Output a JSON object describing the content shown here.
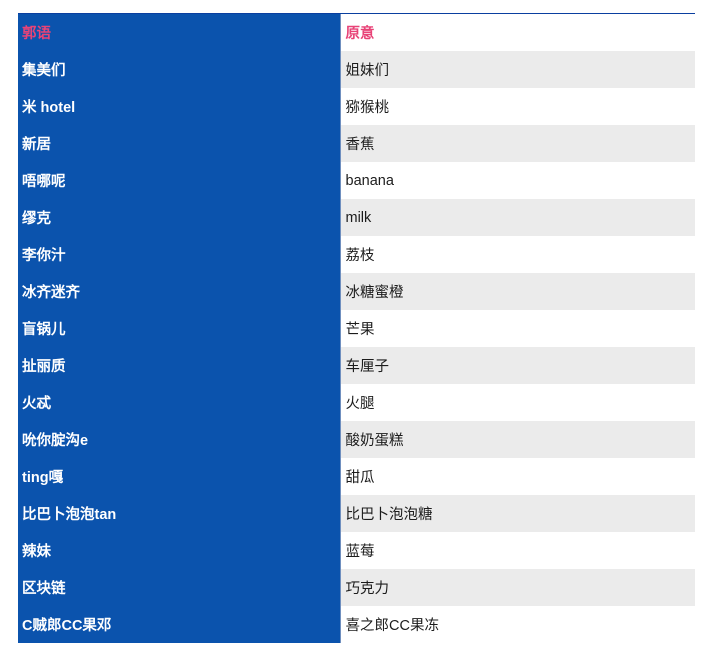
{
  "table": {
    "headers": [
      "郭语",
      "原意"
    ],
    "rows": [
      [
        "集美们",
        "姐妹们"
      ],
      [
        "米 hotel",
        "猕猴桃"
      ],
      [
        "新居",
        "香蕉"
      ],
      [
        "唔哪呢",
        "banana"
      ],
      [
        "缪克",
        "milk"
      ],
      [
        "李你汁",
        "荔枝"
      ],
      [
        "冰齐迷齐",
        "冰糖蜜橙"
      ],
      [
        "盲锅儿",
        "芒果"
      ],
      [
        "扯丽质",
        "车厘子"
      ],
      [
        "火忒",
        "火腿"
      ],
      [
        "吮你腚沟e",
        "酸奶蛋糕"
      ],
      [
        "ting嘎",
        "甜瓜"
      ],
      [
        "比巴卜泡泡tan",
        "比巴卜泡泡糖"
      ],
      [
        "辣妹",
        "蓝莓"
      ],
      [
        "区块链",
        "巧克力"
      ],
      [
        "C贼郎CC果邓",
        "喜之郎CC果冻"
      ]
    ]
  },
  "colors": {
    "left_column_bg": "#0b53ad",
    "header_text": "#e84377",
    "stripe_bg": "#ebebeb"
  }
}
